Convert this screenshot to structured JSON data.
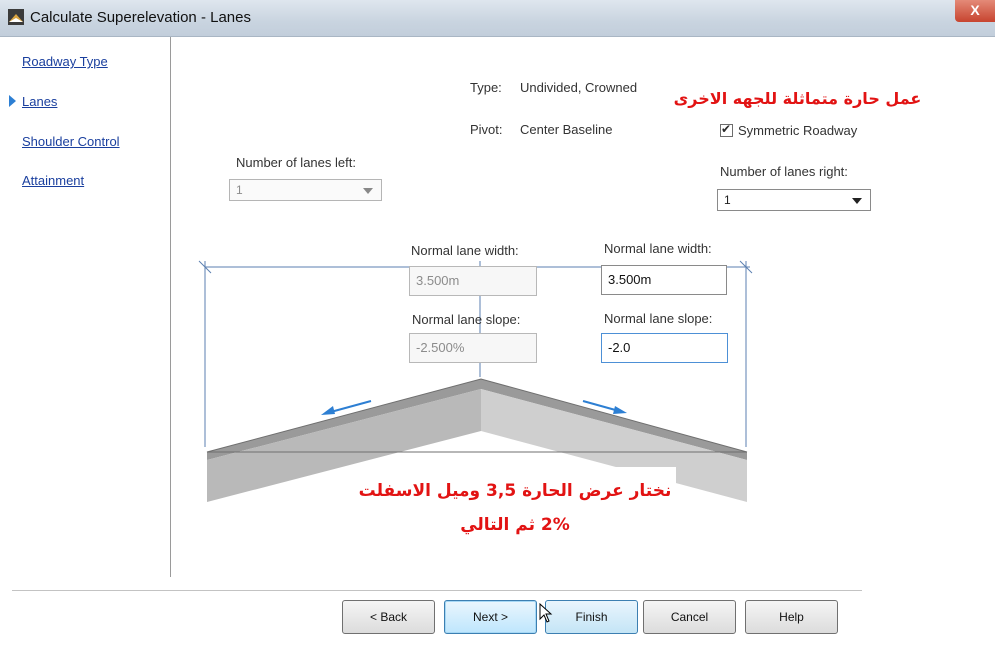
{
  "window": {
    "title": "Calculate Superelevation - Lanes",
    "close_glyph": "X"
  },
  "nav": {
    "items": [
      {
        "label": "Roadway Type",
        "active": false
      },
      {
        "label": "Lanes",
        "active": true
      },
      {
        "label": "Shoulder Control",
        "active": false
      },
      {
        "label": "Attainment",
        "active": false
      }
    ]
  },
  "info": {
    "type_label": "Type:",
    "type_value": "Undivided, Crowned",
    "pivot_label": "Pivot:",
    "pivot_value": "Center Baseline"
  },
  "symmetric": {
    "label": "Symmetric Roadway",
    "checked": true
  },
  "lanes_left": {
    "label": "Number of lanes left:",
    "value": "1"
  },
  "lanes_right": {
    "label": "Number of lanes right:",
    "value": "1"
  },
  "left_lane": {
    "width_label": "Normal lane width:",
    "width_value": "3.500m",
    "slope_label": "Normal lane slope:",
    "slope_value": "-2.500%"
  },
  "right_lane": {
    "width_label": "Normal lane width:",
    "width_value": "3.500m",
    "slope_label": "Normal lane slope:",
    "slope_value": "-2.0"
  },
  "annotations": {
    "top": "عمل حارة متماثلة للجهه الاخرى",
    "bottom_line1": "نختار عرض الحارة 3,5 وميل الاسفلت",
    "bottom_line2": "2% ثم التالي"
  },
  "buttons": {
    "back": "< Back",
    "next": "Next >",
    "finish": "Finish",
    "cancel": "Cancel",
    "help": "Help"
  },
  "colors": {
    "link": "#1a3f9e",
    "annotation": "#e21313",
    "slope_arrow": "#2d7fd3"
  }
}
